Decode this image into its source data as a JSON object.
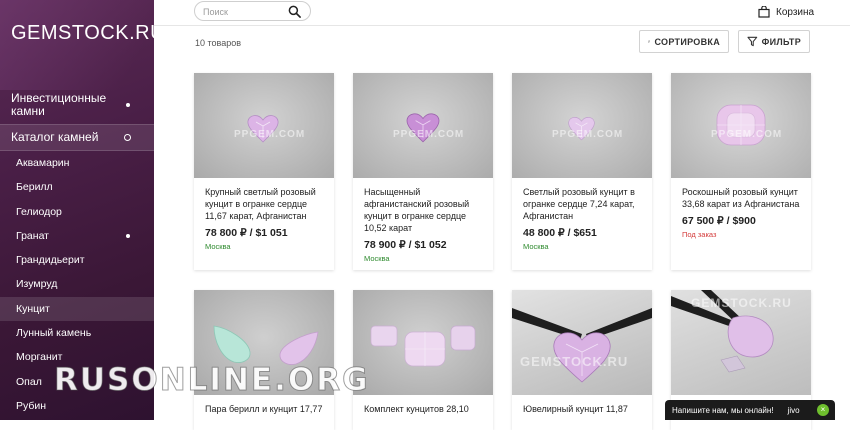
{
  "logo": "GEMSTOCK.RU",
  "sidebar": {
    "top_items": [
      {
        "label": "Инвестиционные камни"
      },
      {
        "label": "Каталог камней"
      }
    ],
    "items": [
      {
        "label": "Аквамарин"
      },
      {
        "label": "Берилл"
      },
      {
        "label": "Гелиодор"
      },
      {
        "label": "Гранат"
      },
      {
        "label": "Грандидьерит"
      },
      {
        "label": "Изумруд"
      },
      {
        "label": "Кунцит"
      },
      {
        "label": "Лунный камень"
      },
      {
        "label": "Морганит"
      },
      {
        "label": "Опал"
      },
      {
        "label": "Рубин"
      }
    ]
  },
  "header": {
    "search_placeholder": "Поиск",
    "cart_label": "Корзина"
  },
  "toolbar": {
    "count": "10 товаров",
    "sort_label": "СОРТИРОВКА",
    "filter_label": "ФИЛЬТР"
  },
  "products": [
    {
      "title": "Крупный светлый розовый кунцит в огранке сердце 11,67 карат, Афганистан",
      "price": "78 800 ₽ / $1 051",
      "location": "Москва"
    },
    {
      "title": "Насыщенный афганистанский розовый кунцит в огранке сердце 10,52 карат",
      "price": "78 900 ₽ / $1 052",
      "location": "Москва"
    },
    {
      "title": "Светлый розовый кунцит в огранке сердце 7,24 карат, Афганистан",
      "price": "48 800 ₽ / $651",
      "location": "Москва"
    },
    {
      "title": "Роскошный розовый кунцит 33,68 карат из Афганистана",
      "price": "67 500 ₽ / $900",
      "location": "Под заказ"
    },
    {
      "title": "Пара берилл и кунцит 17,77"
    },
    {
      "title": "Комплект кунцитов 28,10"
    },
    {
      "title": "Ювелирный кунцит 11,87"
    },
    {
      "title": ""
    }
  ],
  "watermarks": {
    "pp": "PPGEM.COM",
    "gs": "GEMSTOCK.RU"
  },
  "overlay_text": "RUSONLINE.ORG",
  "chat": {
    "label": "Напишите нам, мы онлайн!",
    "brand": "jivo",
    "close": "×"
  },
  "colors": {
    "sidebar": "#4a1f47",
    "location_available": "#2e8a2e",
    "location_order": "#d43b3b"
  }
}
